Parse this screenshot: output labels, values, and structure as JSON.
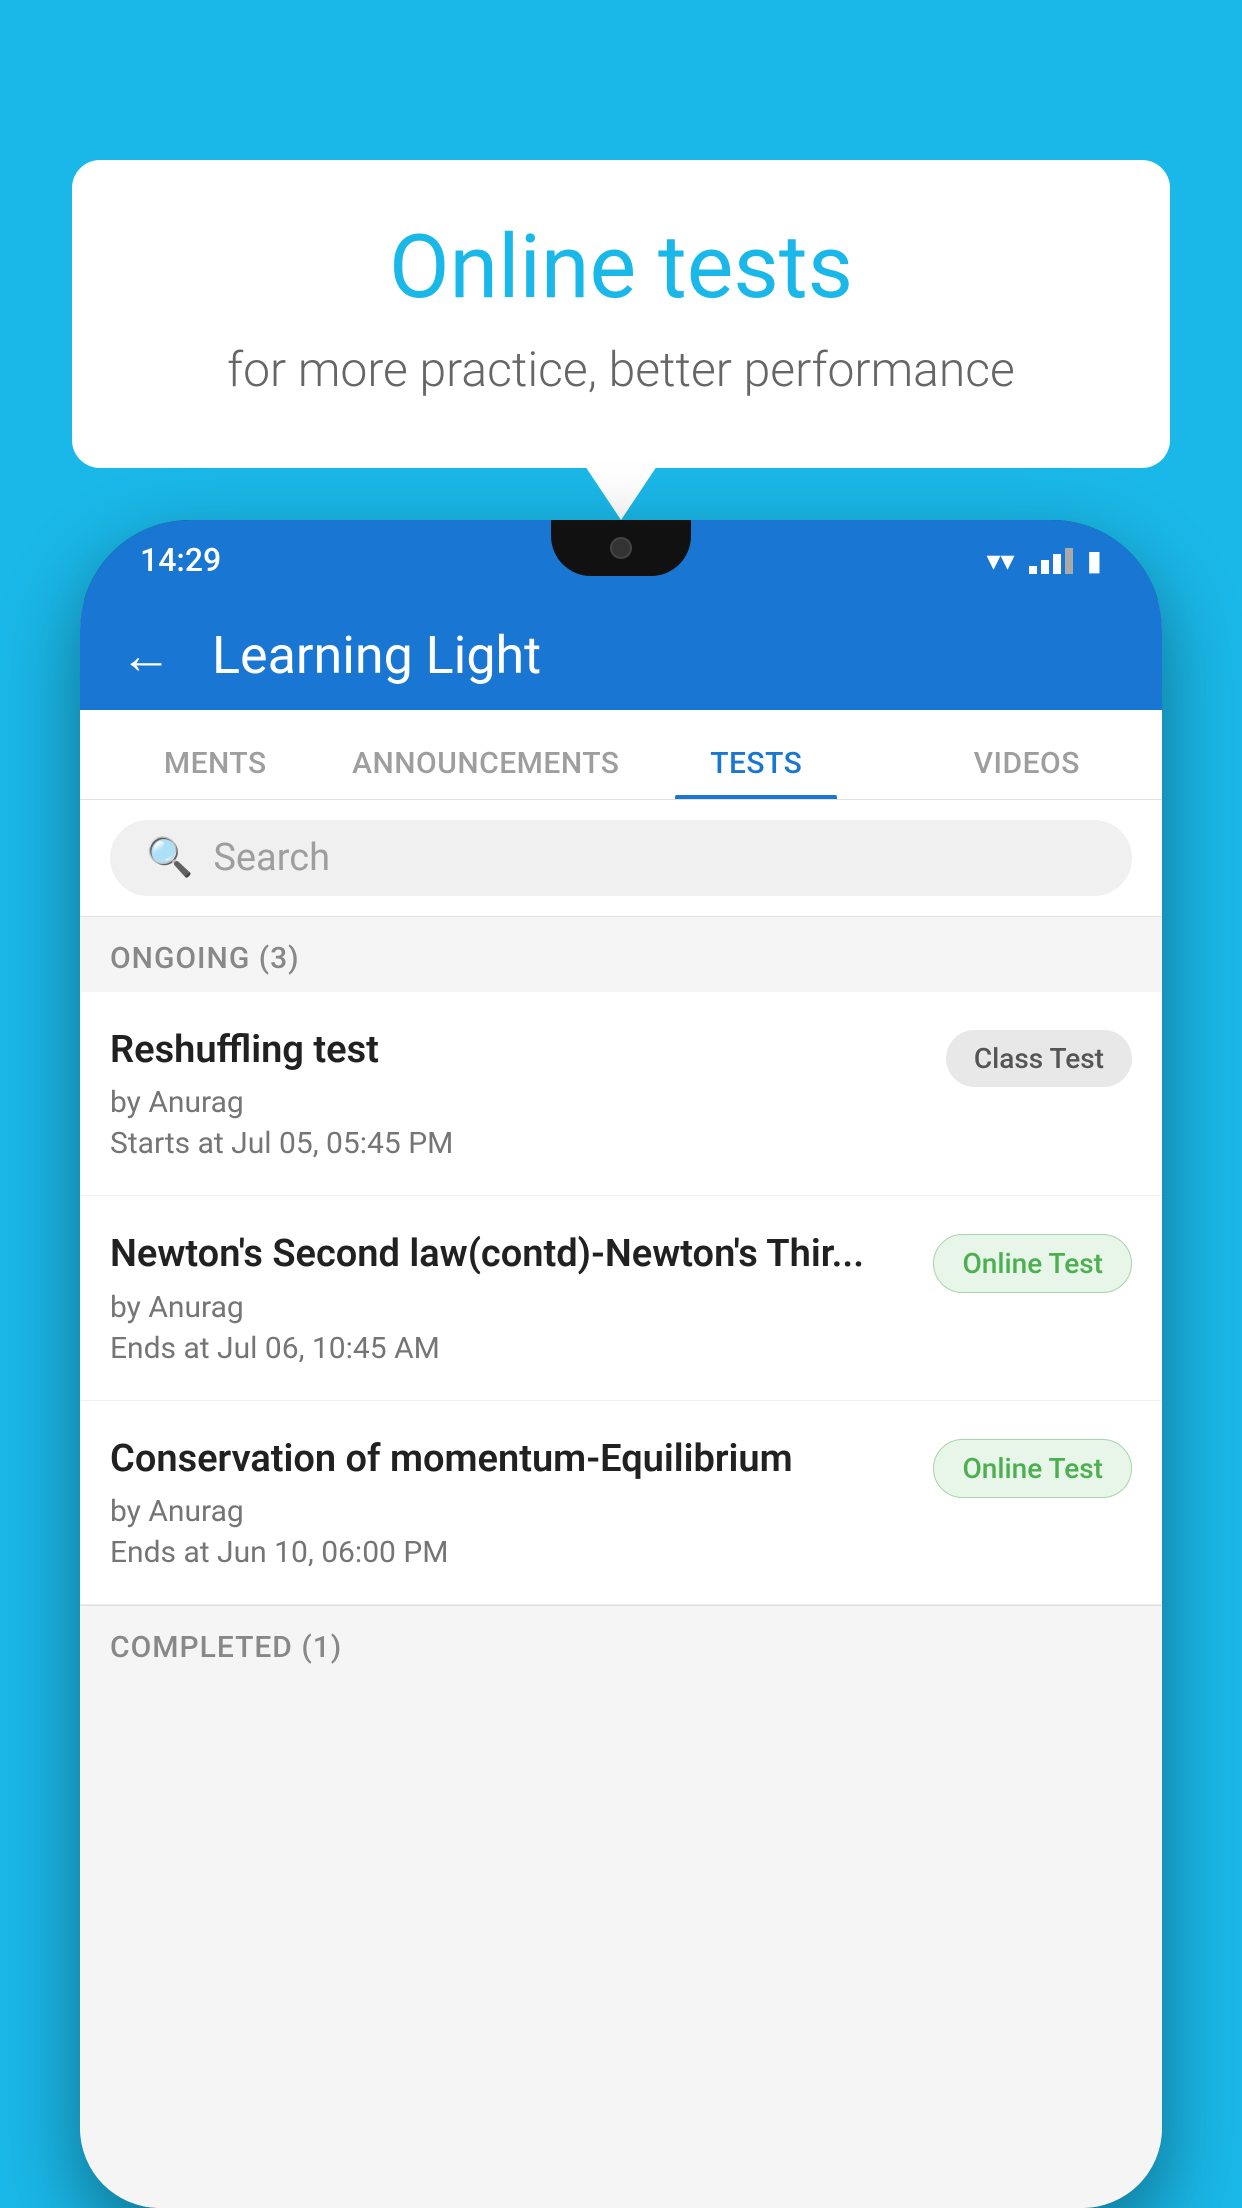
{
  "background_color": "#1ab8e8",
  "bubble": {
    "title": "Online tests",
    "subtitle": "for more practice, better performance"
  },
  "phone": {
    "status_bar": {
      "time": "14:29"
    },
    "header": {
      "title": "Learning Light",
      "back_label": "←"
    },
    "tabs": [
      {
        "label": "MENTS",
        "active": false
      },
      {
        "label": "ANNOUNCEMENTS",
        "active": false
      },
      {
        "label": "TESTS",
        "active": true
      },
      {
        "label": "VIDEOS",
        "active": false
      }
    ],
    "search": {
      "placeholder": "Search"
    },
    "sections": [
      {
        "title": "ONGOING (3)",
        "items": [
          {
            "name": "Reshuffling test",
            "by": "by Anurag",
            "time": "Starts at  Jul 05, 05:45 PM",
            "badge": "Class Test",
            "badge_type": "class"
          },
          {
            "name": "Newton's Second law(contd)-Newton's Thir...",
            "by": "by Anurag",
            "time": "Ends at  Jul 06, 10:45 AM",
            "badge": "Online Test",
            "badge_type": "online"
          },
          {
            "name": "Conservation of momentum-Equilibrium",
            "by": "by Anurag",
            "time": "Ends at  Jun 10, 06:00 PM",
            "badge": "Online Test",
            "badge_type": "online"
          }
        ]
      },
      {
        "title": "COMPLETED (1)",
        "items": []
      }
    ]
  }
}
